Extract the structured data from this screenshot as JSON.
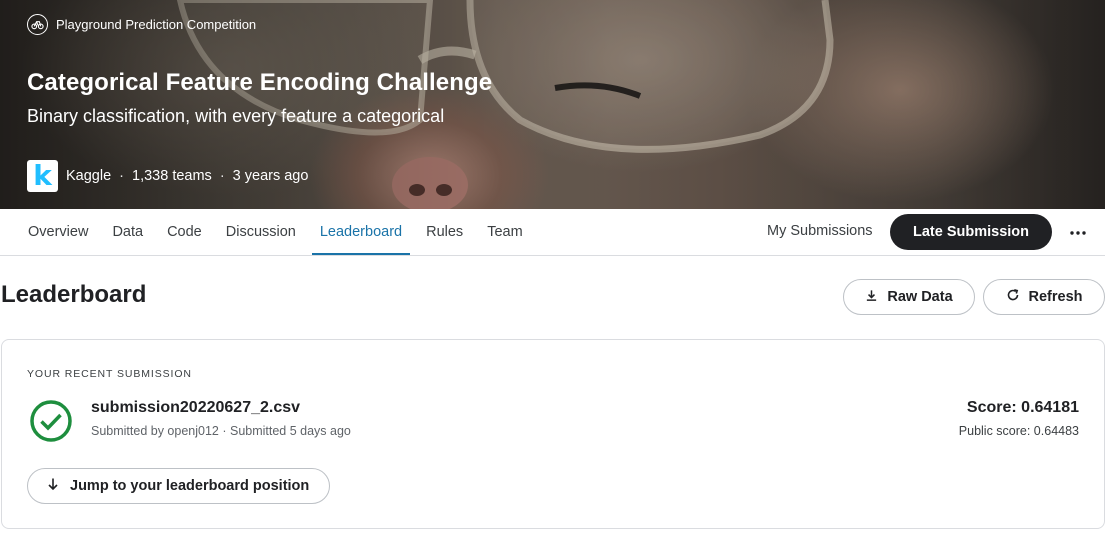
{
  "banner": {
    "competition_type": "Playground Prediction Competition",
    "title": "Categorical Feature Encoding Challenge",
    "subtitle": "Binary classification, with every feature a categorical",
    "host_logo_letter": "k",
    "host": "Kaggle",
    "teams": "1,338 teams",
    "age": "3 years ago",
    "separator": "·"
  },
  "tabs": [
    {
      "label": "Overview"
    },
    {
      "label": "Data"
    },
    {
      "label": "Code"
    },
    {
      "label": "Discussion"
    },
    {
      "label": "Leaderboard",
      "active": true
    },
    {
      "label": "Rules"
    },
    {
      "label": "Team"
    }
  ],
  "tabbar": {
    "my_submissions": "My Submissions",
    "late_submission": "Late Submission",
    "more_icon": "more-horizontal-icon"
  },
  "leaderboard": {
    "title": "Leaderboard",
    "raw_data_label": "Raw Data",
    "refresh_label": "Refresh"
  },
  "recent_submission": {
    "section_label": "YOUR RECENT SUBMISSION",
    "status_icon": "check-circle-icon",
    "filename": "submission20220627_2.csv",
    "byline": "Submitted by openj012 · Submitted 5 days ago",
    "score": "Score: 0.64181",
    "public_score": "Public score: 0.64483",
    "jump_label": "Jump to your leaderboard position"
  },
  "colors": {
    "accent": "#1a73a8",
    "success": "#1e8e3e",
    "dark_button": "#202124",
    "kaggle_blue": "#20beff"
  }
}
